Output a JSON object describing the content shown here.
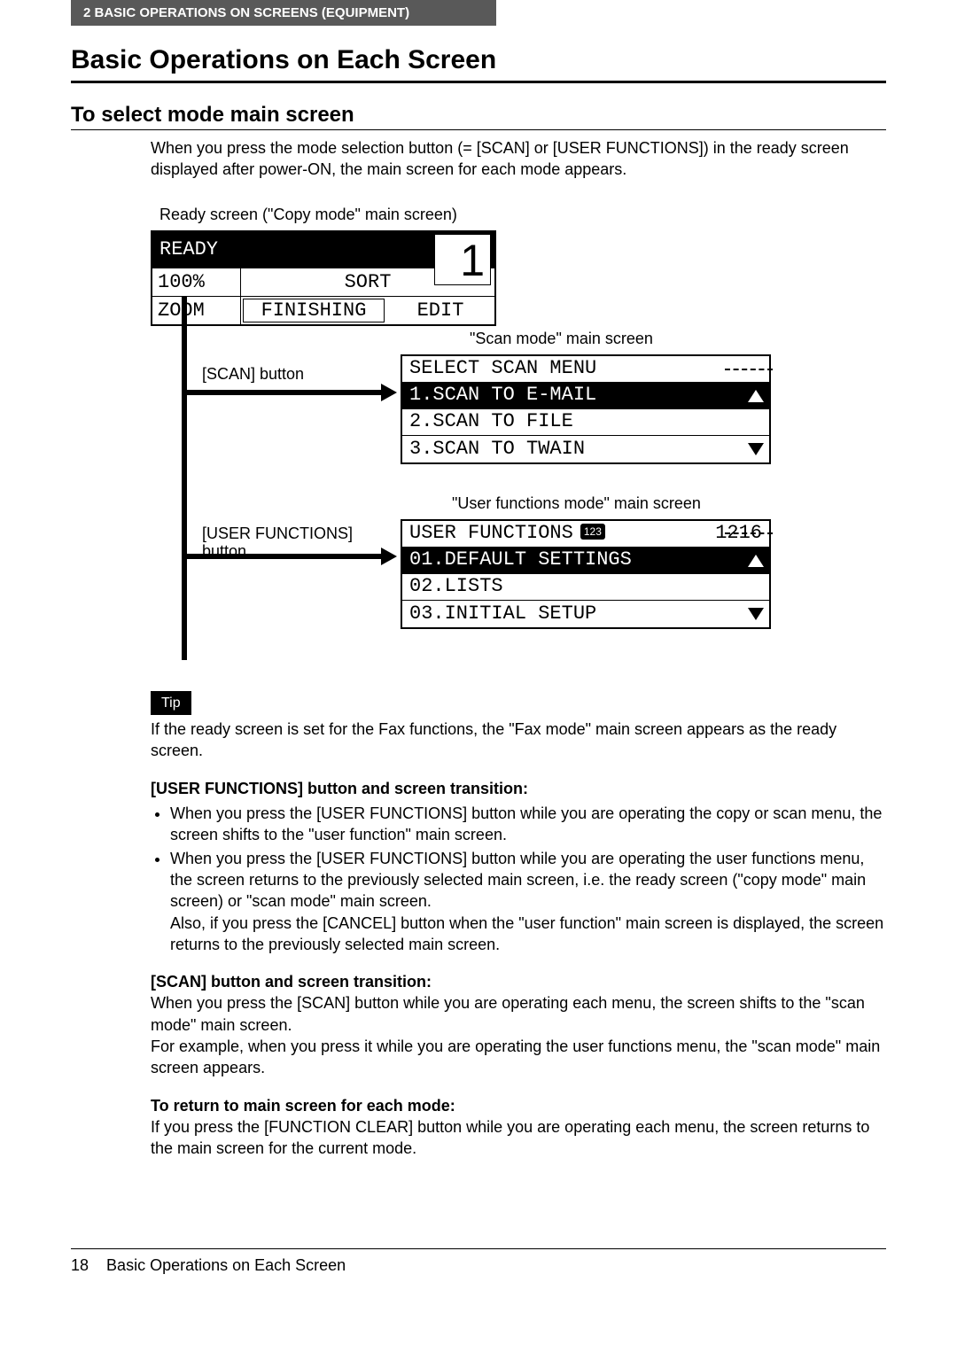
{
  "header_bar": "2   BASIC OPERATIONS ON SCREENS (EQUIPMENT)",
  "h1": "Basic Operations on Each Screen",
  "h2": "To select mode main screen",
  "intro": "When you press the mode selection button (= [SCAN] or [USER FUNCTIONS]) in the ready screen displayed after power-ON, the main screen for each mode appears.",
  "ready_caption": "Ready screen (\"Copy mode\" main screen)",
  "ready_lcd": {
    "row1": "READY",
    "big_number": "1",
    "row2_left": "100%",
    "row2_right": "SORT",
    "row3_left": "ZOOM",
    "row3_mid": "FINISHING",
    "row3_right": "EDIT"
  },
  "branch1_label": "[SCAN] button",
  "branch2_label": "[USER FUNCTIONS] button",
  "scan_caption": "\"Scan mode\" main screen",
  "scan_lcd": {
    "l1": "SELECT SCAN MENU",
    "l2": "1.SCAN TO E-MAIL",
    "l3": "2.SCAN TO FILE",
    "l4": "3.SCAN TO TWAIN"
  },
  "user_caption": "\"User functions mode\" main screen",
  "user_lcd": {
    "l1_left": "USER FUNCTIONS",
    "l1_badge": "123",
    "l1_right": "1216",
    "l2": "01.DEFAULT SETTINGS",
    "l3": "02.LISTS",
    "l4": "03.INITIAL SETUP"
  },
  "tip_label": "Tip",
  "tip_text": "If the ready screen is set for the Fax functions, the \"Fax mode\" main screen appears as the ready screen.",
  "uf_heading": "[USER FUNCTIONS] button and screen transition:",
  "uf_b1": "When you press the [USER FUNCTIONS] button while you are operating the copy or scan menu, the screen shifts to the \"user function\" main screen.",
  "uf_b2": "When you press the [USER FUNCTIONS] button while you are operating the user functions menu, the screen returns to the previously selected main screen, i.e. the ready screen (\"copy mode\" main screen) or \"scan mode\" main screen.",
  "uf_b2b": "Also, if you press the [CANCEL] button when the \"user function\" main screen is displayed, the screen returns to the previously selected main screen.",
  "scan_heading": "[SCAN] button and screen transition:",
  "scan_p1": "When you press the [SCAN] button while you are operating each menu, the screen shifts to the \"scan mode\" main screen.",
  "scan_p2": "For example, when you press it while you are operating the user functions menu, the \"scan mode\" main screen appears.",
  "return_heading": "To return to main screen for each mode:",
  "return_text": "If you press the [FUNCTION CLEAR] button while you are operating each menu, the screen returns to the main screen for the current mode.",
  "footer_page": "18",
  "footer_text": "Basic Operations on Each Screen"
}
